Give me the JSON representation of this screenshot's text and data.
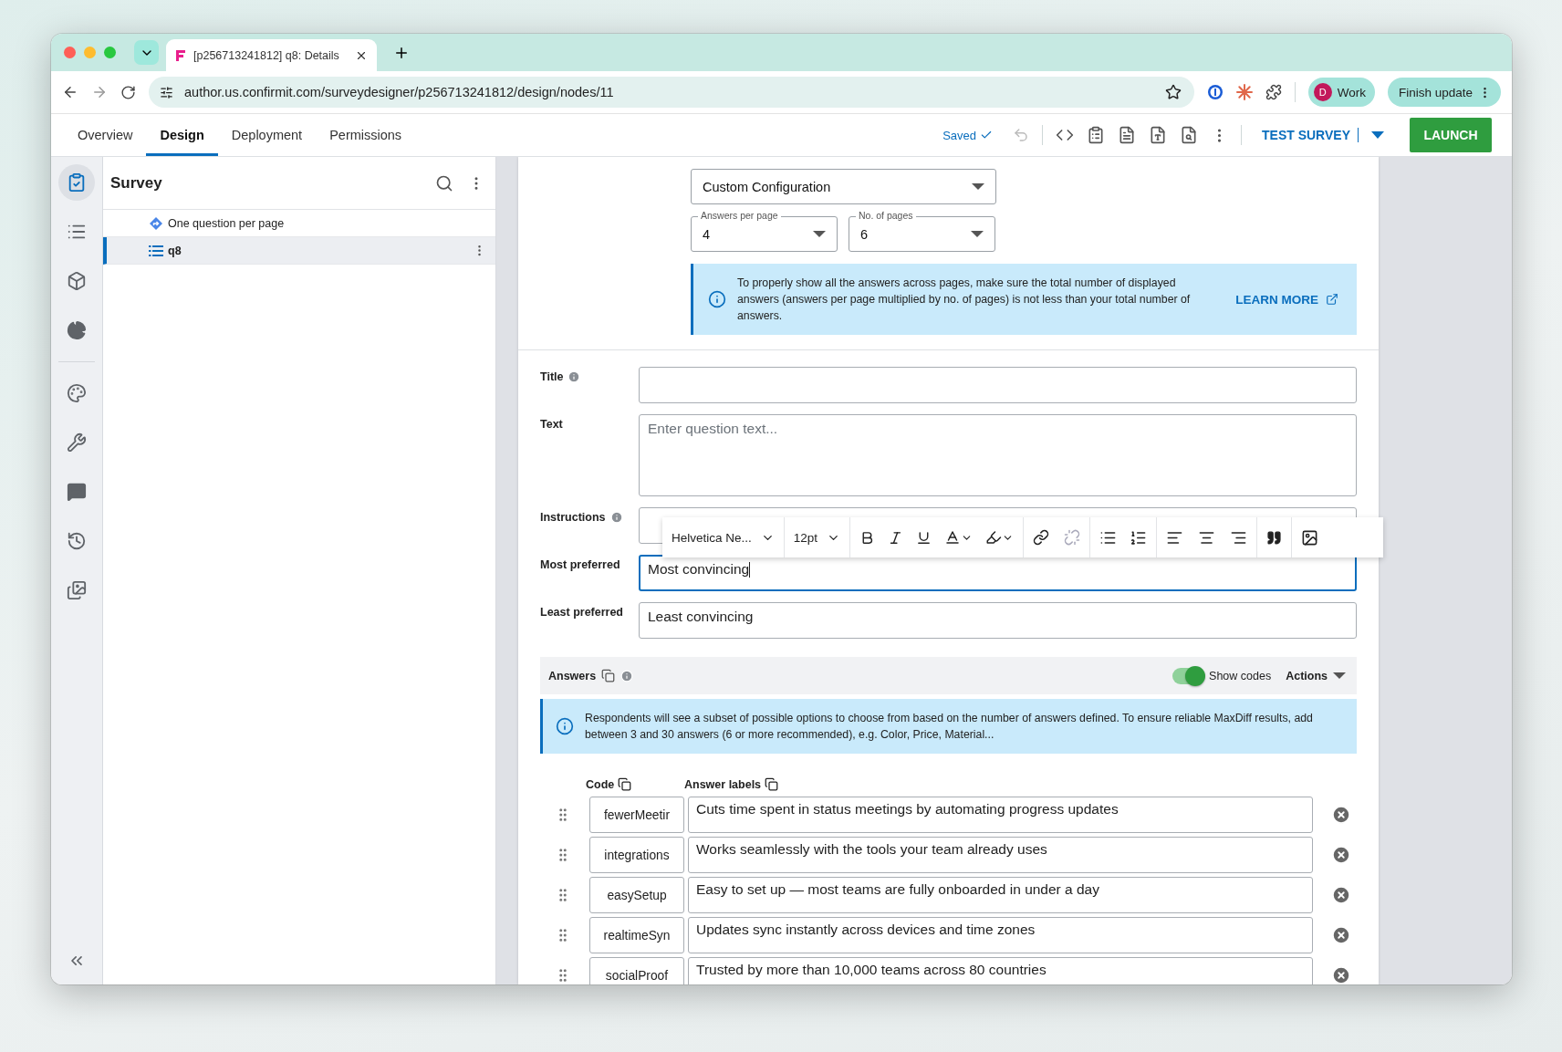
{
  "browser": {
    "tab_title": "[p256713241812] q8: Details",
    "url": "author.us.confirmit.com/surveydesigner/p256713241812/design/nodes/11",
    "profile": {
      "initial": "D",
      "label": "Work"
    },
    "update_button": "Finish update"
  },
  "app_nav": {
    "tabs": [
      {
        "label": "Overview",
        "selected": false
      },
      {
        "label": "Design",
        "selected": true
      },
      {
        "label": "Deployment",
        "selected": false
      },
      {
        "label": "Permissions",
        "selected": false
      }
    ],
    "saved": "Saved",
    "test_survey": "TEST SURVEY",
    "launch": "LAUNCH"
  },
  "rail": {
    "top": [
      {
        "kind": "survey",
        "selected": true
      },
      {
        "kind": "list",
        "selected": false
      },
      {
        "kind": "cube",
        "selected": false
      },
      {
        "kind": "pie",
        "selected": false
      }
    ],
    "bottom": [
      {
        "kind": "palette",
        "selected": false
      },
      {
        "kind": "wrench",
        "selected": false
      },
      {
        "kind": "chat",
        "selected": false
      },
      {
        "kind": "history",
        "selected": false
      },
      {
        "kind": "media",
        "selected": false
      }
    ]
  },
  "tree": {
    "title": "Survey",
    "items": [
      {
        "label": "One question per page",
        "kind": "page",
        "selected": false
      },
      {
        "label": "q8",
        "kind": "question",
        "selected": true
      }
    ]
  },
  "config": {
    "dropdown": "Custom Configuration",
    "answers_per_page": {
      "label": "Answers per page",
      "value": "4"
    },
    "pages": {
      "label": "No. of pages",
      "value": "6"
    },
    "notice": "To properly show all the answers across pages, make sure the total number of displayed answers (answers per page multiplied by no. of pages) is not less than your total number of answers.",
    "learn_more": "LEARN MORE"
  },
  "fields": [
    {
      "label": "Title",
      "info": true,
      "kind": "line",
      "focused": false
    },
    {
      "label": "Text",
      "info": false,
      "kind": "area",
      "placeholder": "Enter question text...",
      "focused": false
    },
    {
      "label": "Instructions",
      "info": true,
      "kind": "editor",
      "focused": false
    },
    {
      "label": "Most preferred",
      "info": false,
      "kind": "line",
      "value": "Most convincing",
      "focused": true
    },
    {
      "label": "Least preferred",
      "info": false,
      "kind": "line",
      "value": "Least convincing",
      "focused": false
    }
  ],
  "editor_toolbar": {
    "font": "Helvetica Ne...",
    "size": "12pt"
  },
  "answers": {
    "title": "Answers",
    "show_codes": true,
    "show_codes_label": "Show codes",
    "actions": "Actions",
    "notice": "Respondents will see a subset of possible options to choose from based on the number of answers defined. To ensure reliable MaxDiff results, add between 3 and 30 answers (6 or more recommended), e.g. Color, Price, Material...",
    "code_header": "Code",
    "label_header": "Answer labels",
    "rows": [
      {
        "code": "fewerMeetir",
        "label": "Cuts time spent in status meetings by automating progress updates"
      },
      {
        "code": "integrations",
        "label": "Works seamlessly with the tools your team already uses"
      },
      {
        "code": "easySetup",
        "label": "Easy to set up — most teams are fully onboarded in under a day"
      },
      {
        "code": "realtimeSyn",
        "label": "Updates sync instantly across devices and time zones"
      },
      {
        "code": "socialProof",
        "label": "Trusted by more than 10,000 teams across 80 countries"
      }
    ]
  }
}
